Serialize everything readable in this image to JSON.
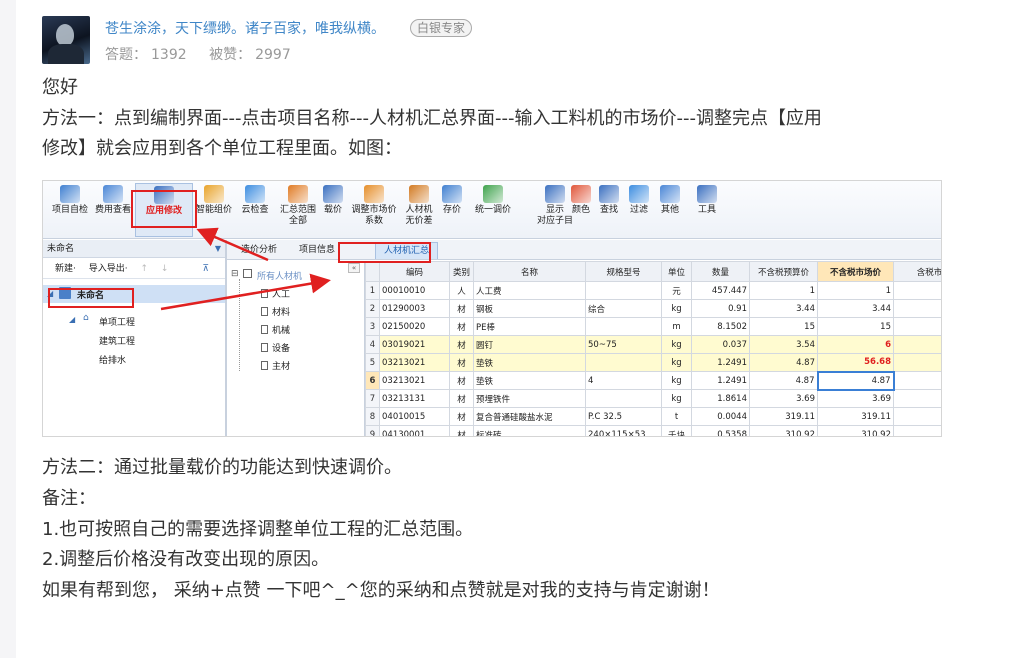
{
  "answer": {
    "username": "苍生涂涂，天下缥缈。诸子百家，唯我纵横。",
    "badge": "白银专家",
    "answers_label": "答题：",
    "answers_count": "1392",
    "likes_label": "被赞：",
    "likes_count": "2997"
  },
  "body": {
    "greeting": "您好",
    "method1_line1": "方法一：点到编制界面---点击项目名称---人材机汇总界面---输入工料机的市场价---调整完点【应用",
    "method1_line2": "修改】就会应用到各个单位工程里面。如图：",
    "method2": "方法二：通过批量载价的功能达到快速调价。",
    "note_title": "备注：",
    "note1": "1.也可按照自己的需要选择调整单位工程的汇总范围。",
    "note2": "2.调整后价格没有改变出现的原因。",
    "closing": "如果有帮到您， 采纳+点赞 一下吧^_^您的采纳和点赞就是对我的支持与肯定谢谢！"
  },
  "screenshot": {
    "ribbon": [
      {
        "l1": "项目自检",
        "l2": "",
        "icon_color": "#3f7fd0"
      },
      {
        "l1": "费用查看",
        "l2": "",
        "icon_color": "#4a86d6"
      },
      {
        "l1": "应用修改",
        "l2": "",
        "icon_color": "#3a6fc0"
      },
      {
        "l1": "智能组价",
        "l2": "",
        "icon_color": "#e8a32a"
      },
      {
        "l1": "云检查",
        "l2": "",
        "icon_color": "#3d8de0"
      },
      {
        "l1": "汇总范围",
        "l2": "全部",
        "icon_color": "#e07b25"
      },
      {
        "l1": "载价",
        "l2": "",
        "icon_color": "#3a6fc0"
      },
      {
        "l1": "调整市场价",
        "l2": "系数",
        "icon_color": "#e58e2a"
      },
      {
        "l1": "人材机",
        "l2": "无价差",
        "icon_color": "#d27a22"
      },
      {
        "l1": "存价",
        "l2": "",
        "icon_color": "#3f7fd0"
      },
      {
        "l1": "统一调价",
        "l2": "",
        "icon_color": "#3fa34d"
      },
      {
        "l1": "显示",
        "l2": "对应子目",
        "icon_color": "#3a6fc0"
      },
      {
        "l1": "颜色",
        "l2": "",
        "icon_color": "#e0563a"
      },
      {
        "l1": "查找",
        "l2": "",
        "icon_color": "#3a6fc0"
      },
      {
        "l1": "过滤",
        "l2": "",
        "icon_color": "#3d8de0"
      },
      {
        "l1": "其他",
        "l2": "",
        "icon_color": "#4a86d6"
      },
      {
        "l1": "工具",
        "l2": "",
        "icon_color": "#3a6fc0"
      }
    ],
    "project_title": "未命名",
    "project_tools": [
      "新建·",
      "导入导出·",
      "↑",
      "↓"
    ],
    "pin": "⊼",
    "tree": {
      "root": "未命名",
      "child": "单项工程",
      "leaf1": "建筑工程",
      "leaf2": "给排水"
    },
    "tabs": [
      "造价分析",
      "项目信息",
      "人材机汇总"
    ],
    "collapse": "«",
    "categories_root": "所有人材机",
    "categories": [
      "人工",
      "材料",
      "机械",
      "设备",
      "主材"
    ],
    "columns": [
      "编码",
      "类别",
      "名称",
      "规格型号",
      "单位",
      "数量",
      "不含税预算价",
      "不含税市场价",
      "含税市"
    ],
    "rows": [
      {
        "n": "1",
        "code": "00010010",
        "type": "人",
        "name": "人工费",
        "spec": "",
        "unit": "元",
        "qty": "457.447",
        "budget": "1",
        "market": "1",
        "style": ""
      },
      {
        "n": "2",
        "code": "01290003",
        "type": "材",
        "name": "钢板",
        "spec": "综合",
        "unit": "kg",
        "qty": "0.91",
        "budget": "3.44",
        "market": "3.44",
        "style": ""
      },
      {
        "n": "3",
        "code": "02150020",
        "type": "材",
        "name": "PE棒",
        "spec": "",
        "unit": "m",
        "qty": "8.1502",
        "budget": "15",
        "market": "15",
        "style": ""
      },
      {
        "n": "4",
        "code": "03019021",
        "type": "材",
        "name": "圆钉",
        "spec": "50~75",
        "unit": "kg",
        "qty": "0.037",
        "budget": "3.54",
        "market": "6",
        "style": "yellow"
      },
      {
        "n": "5",
        "code": "03213021",
        "type": "材",
        "name": "垫铁",
        "spec": "",
        "unit": "kg",
        "qty": "1.2491",
        "budget": "4.87",
        "market": "56.68",
        "style": "yellow"
      },
      {
        "n": "6",
        "code": "03213021",
        "type": "材",
        "name": "垫铁",
        "spec": "4",
        "unit": "kg",
        "qty": "1.2491",
        "budget": "4.87",
        "market": "4.87",
        "style": "edit"
      },
      {
        "n": "7",
        "code": "03213131",
        "type": "材",
        "name": "预埋铁件",
        "spec": "",
        "unit": "kg",
        "qty": "1.8614",
        "budget": "3.69",
        "market": "3.69",
        "style": ""
      },
      {
        "n": "8",
        "code": "04010015",
        "type": "材",
        "name": "复合普通硅酸盐水泥",
        "spec": "P.C 32.5",
        "unit": "t",
        "qty": "0.0044",
        "budget": "319.11",
        "market": "319.11",
        "style": ""
      },
      {
        "n": "9",
        "code": "04130001",
        "type": "材",
        "name": "标准砖",
        "spec": "240×115×53",
        "unit": "千块",
        "qty": "0.5358",
        "budget": "310.92",
        "market": "310.92",
        "style": ""
      }
    ]
  }
}
